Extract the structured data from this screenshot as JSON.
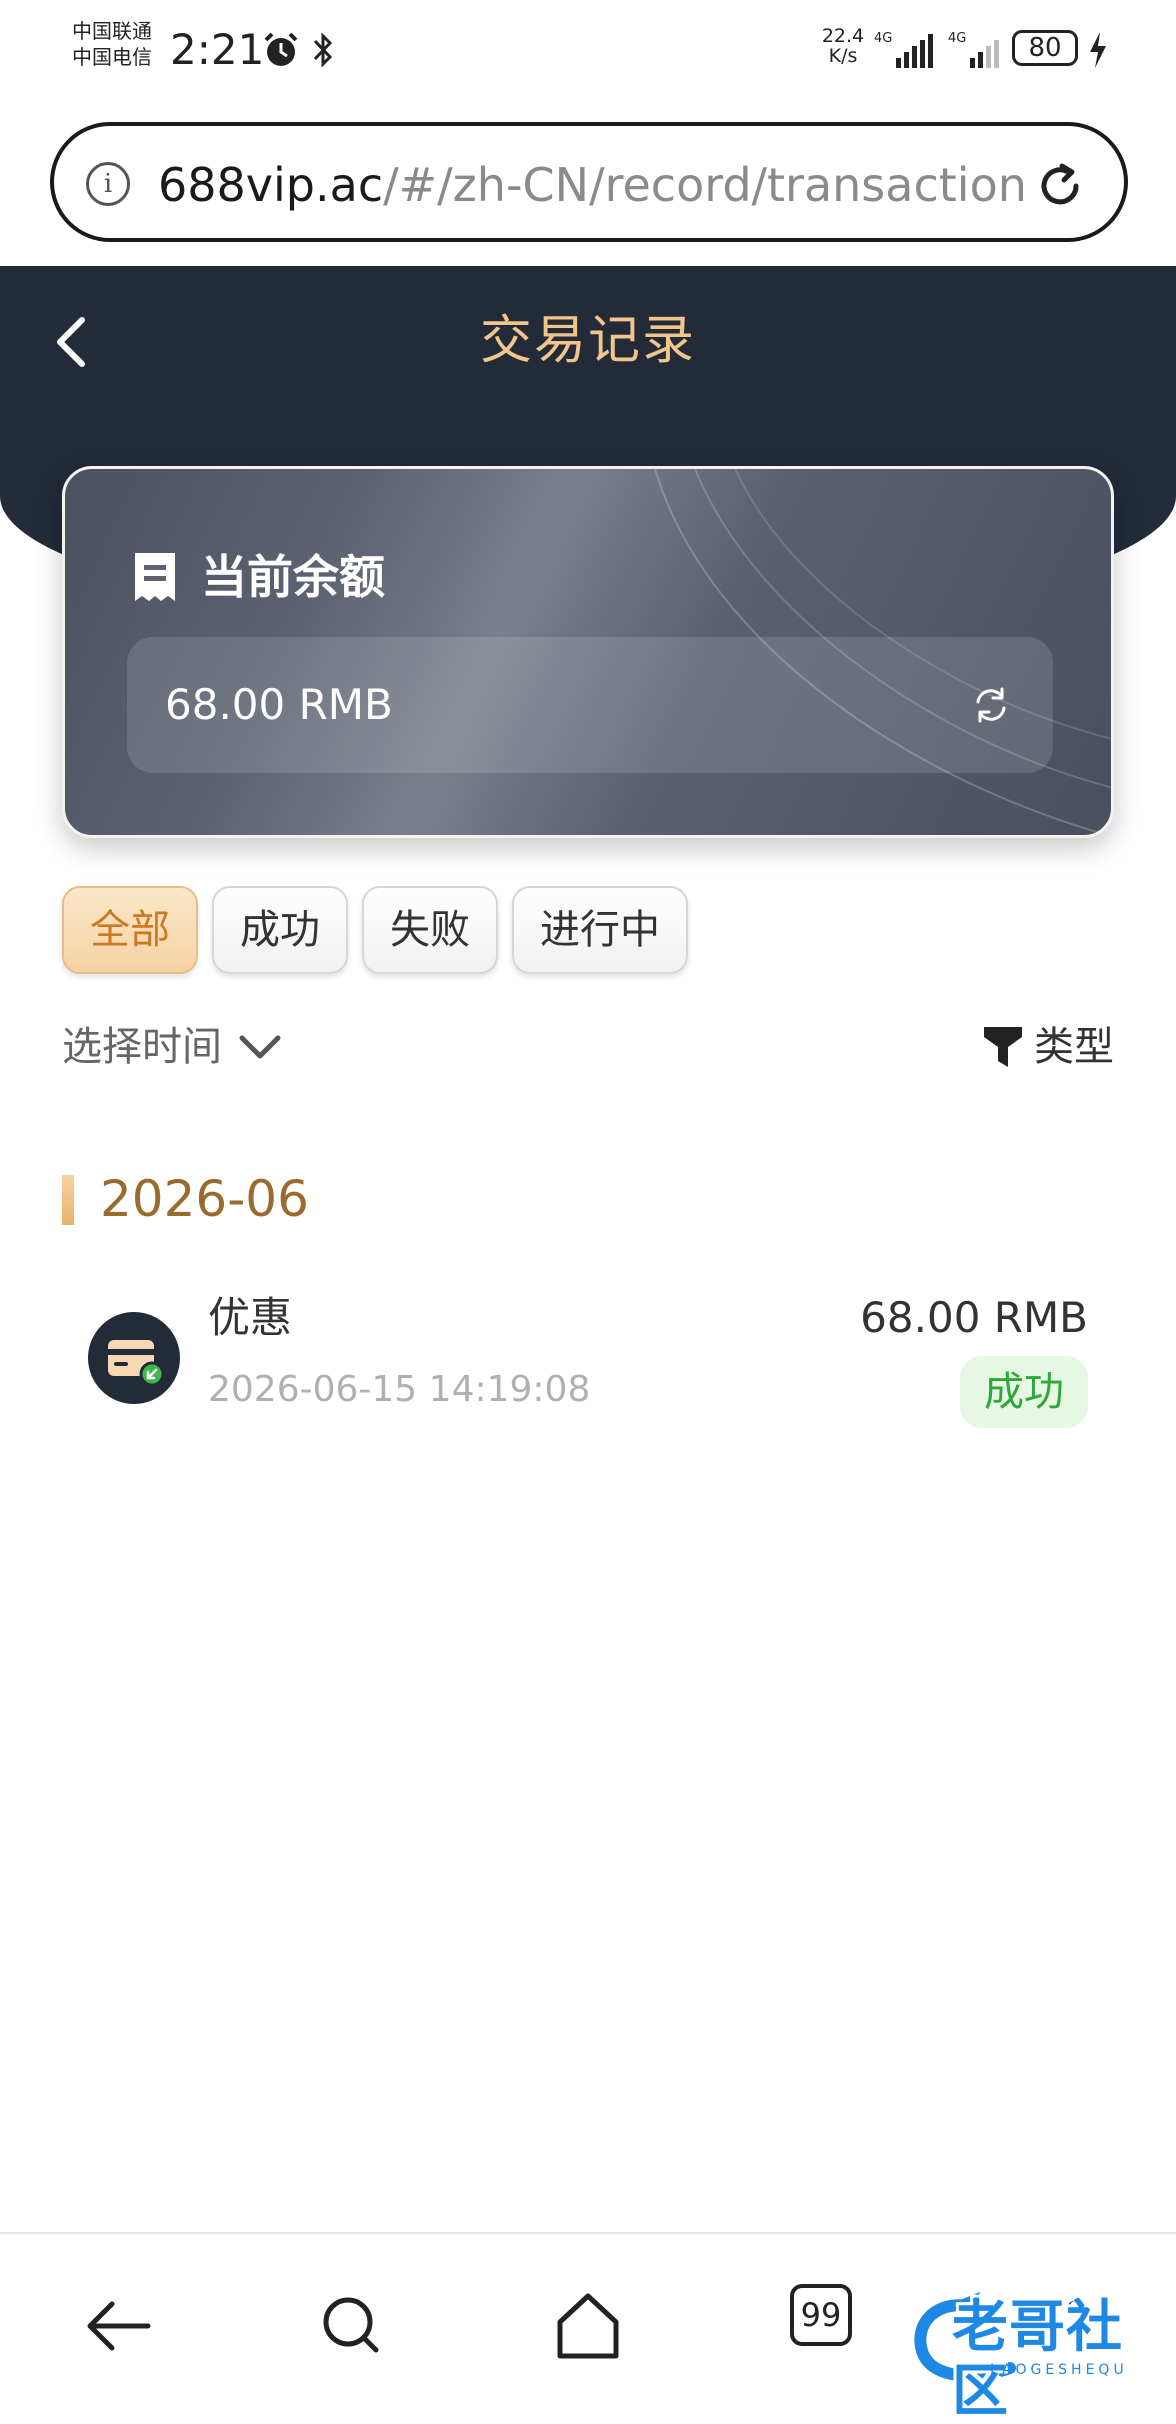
{
  "status_bar": {
    "carrier_1": "中国联通",
    "carrier_2": "中国电信",
    "time": "2:21",
    "net_speed_value": "22.4",
    "net_speed_unit": "K/s",
    "network_1": "4G",
    "network_2": "4G",
    "battery": "80",
    "icons": [
      "alarm-icon",
      "bluetooth-icon",
      "signal-icon",
      "charging-icon"
    ]
  },
  "browser": {
    "url_host": "688vip.ac",
    "url_path": "/#/zh-CN/record/transaction"
  },
  "header": {
    "title": "交易记录"
  },
  "balance_card": {
    "label": "当前余额",
    "value": "68.00 RMB"
  },
  "filters": {
    "tabs": [
      {
        "label": "全部",
        "active": true
      },
      {
        "label": "成功",
        "active": false
      },
      {
        "label": "失败",
        "active": false
      },
      {
        "label": "进行中",
        "active": false
      }
    ]
  },
  "toolbar": {
    "time_select_label": "选择时间",
    "type_filter_label": "类型"
  },
  "groups": [
    {
      "month": "2026-06",
      "transactions": [
        {
          "title": "优惠",
          "time": "2026-06-15 14:19:08",
          "amount": "68.00 RMB",
          "status": "成功"
        }
      ]
    }
  ],
  "bottom_nav": {
    "tabs_count": "99",
    "items": [
      "back-icon",
      "search-icon",
      "home-icon",
      "tabs-icon",
      "more-icon"
    ]
  },
  "watermark": {
    "text": "老哥社区",
    "sub": "LAOGESHEQU"
  },
  "colors": {
    "header_bg": "#232a38",
    "title_gold": "#f1c58c",
    "active_chip_bg": "#f6d3a5",
    "active_chip_text": "#cc7a22",
    "month_text": "#9a6a2e",
    "success_text": "#2fa83a",
    "success_bg": "#e6f7e4"
  }
}
